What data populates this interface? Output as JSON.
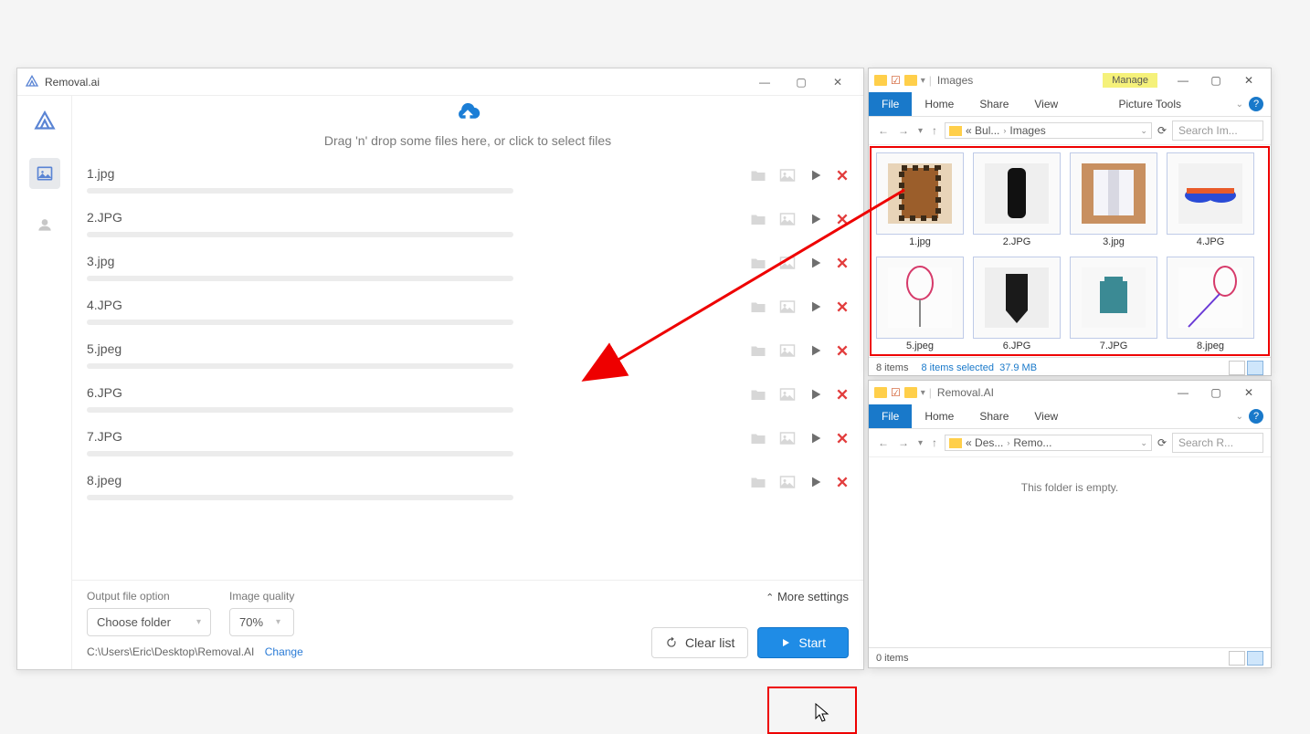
{
  "app": {
    "title": "Removal.ai",
    "dropzone_text": "Drag 'n' drop some files here, or click to select files",
    "files": [
      {
        "name": "1.jpg"
      },
      {
        "name": "2.JPG"
      },
      {
        "name": "3.jpg"
      },
      {
        "name": "4.JPG"
      },
      {
        "name": "5.jpeg"
      },
      {
        "name": "6.JPG"
      },
      {
        "name": "7.JPG"
      },
      {
        "name": "8.jpeg"
      }
    ],
    "output_label": "Output file option",
    "output_value": "Choose folder",
    "quality_label": "Image quality",
    "quality_value": "70%",
    "path": "C:\\Users\\Eric\\Desktop\\Removal.AI",
    "change": "Change",
    "more_settings": "More settings",
    "clear": "Clear list",
    "start": "Start"
  },
  "explorer1": {
    "title": "Images",
    "manage": "Manage",
    "tabs": {
      "file": "File",
      "home": "Home",
      "share": "Share",
      "view": "View",
      "tools": "Picture Tools"
    },
    "breadcrumb": {
      "p1": "« Bul...",
      "p2": "Images"
    },
    "search_ph": "Search Im...",
    "thumbs": [
      {
        "name": "1.jpg"
      },
      {
        "name": "2.JPG"
      },
      {
        "name": "3.jpg"
      },
      {
        "name": "4.JPG"
      },
      {
        "name": "5.jpeg"
      },
      {
        "name": "6.JPG"
      },
      {
        "name": "7.JPG"
      },
      {
        "name": "8.jpeg"
      }
    ],
    "status_items": "8 items",
    "status_sel": "8 items selected",
    "status_size": "37.9 MB"
  },
  "explorer2": {
    "title": "Removal.AI",
    "tabs": {
      "file": "File",
      "home": "Home",
      "share": "Share",
      "view": "View"
    },
    "breadcrumb": {
      "p1": "« Des...",
      "p2": "Remo..."
    },
    "search_ph": "Search R...",
    "empty": "This folder is empty.",
    "status_items": "0 items"
  }
}
